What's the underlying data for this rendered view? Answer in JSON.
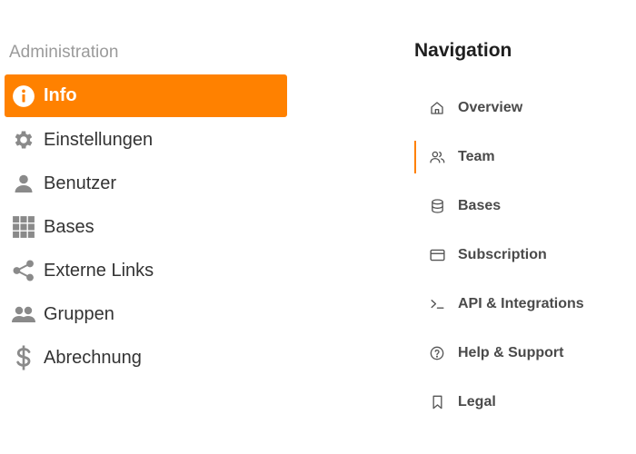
{
  "admin": {
    "title": "Administration",
    "items": [
      {
        "label": "Info",
        "icon": "info-icon",
        "active": true
      },
      {
        "label": "Einstellungen",
        "icon": "gear-icon",
        "active": false
      },
      {
        "label": "Benutzer",
        "icon": "user-icon",
        "active": false
      },
      {
        "label": "Bases",
        "icon": "grid-icon",
        "active": false
      },
      {
        "label": "Externe Links",
        "icon": "share-icon",
        "active": false
      },
      {
        "label": "Gruppen",
        "icon": "group-icon",
        "active": false
      },
      {
        "label": "Abrechnung",
        "icon": "dollar-icon",
        "active": false
      }
    ]
  },
  "nav": {
    "title": "Navigation",
    "items": [
      {
        "label": "Overview",
        "icon": "home-icon",
        "active": false
      },
      {
        "label": "Team",
        "icon": "users-icon",
        "active": true
      },
      {
        "label": "Bases",
        "icon": "database-icon",
        "active": false
      },
      {
        "label": "Subscription",
        "icon": "credit-card-icon",
        "active": false
      },
      {
        "label": "API & Integrations",
        "icon": "terminal-icon",
        "active": false
      },
      {
        "label": "Help & Support",
        "icon": "help-circle-icon",
        "active": false
      },
      {
        "label": "Legal",
        "icon": "bookmark-icon",
        "active": false
      }
    ]
  },
  "colors": {
    "accent": "#ff8100",
    "icon_gray": "#8a8a8a",
    "text": "#333333",
    "muted": "#9b9b9b"
  }
}
